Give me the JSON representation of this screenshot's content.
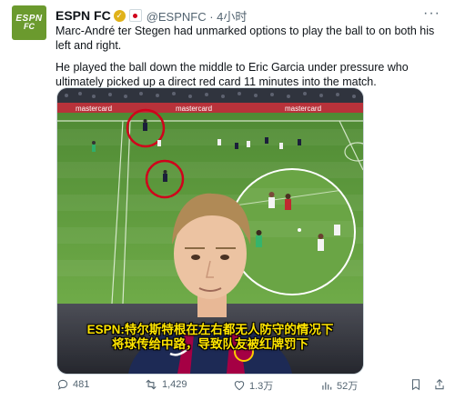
{
  "account": {
    "logo_line1": "ESPN",
    "logo_line2": "FC",
    "name": "ESPN FC",
    "handle_time": "@ESPNFC · 4小时"
  },
  "more_label": "···",
  "tweet": {
    "paragraph1": "Marc-André ter Stegen had unmarked options to play the ball to on both his left and right.",
    "paragraph2": "He played the ball down the middle to Eric Garcia under pressure who ultimately picked up a direct red card 11 minutes into the match."
  },
  "media": {
    "ad_boards": [
      "mastercard",
      "mastercard",
      "mastercard"
    ],
    "subtitle_line1": "ESPN:特尔斯特根在左右都无人防守的情况下",
    "subtitle_line2": "将球传给中路，导致队友被红牌罚下",
    "highlight_color": "#d0021b",
    "pitch_color": "#5f9a3e",
    "subtitle_color": "#ffe500"
  },
  "actions": {
    "replies": "481",
    "reposts": "1,429",
    "likes": "1.3万",
    "views": "52万"
  },
  "colors": {
    "accent_logo": "#6b9a2e",
    "text_secondary": "#536471"
  }
}
